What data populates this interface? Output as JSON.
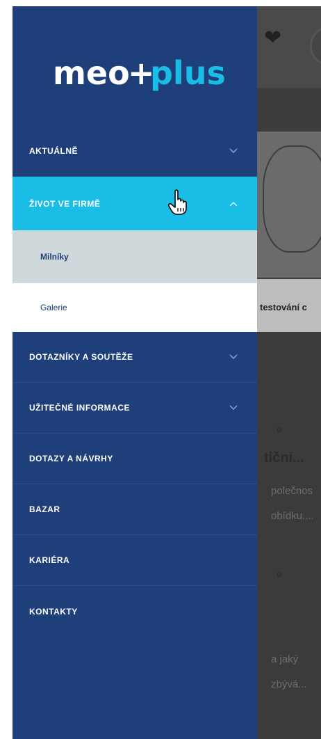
{
  "brand": {
    "logo_text": "meo+plus"
  },
  "nav": {
    "items": [
      {
        "label": "AKTUÁLNĚ",
        "has_chevron": true,
        "state": "collapsed"
      },
      {
        "label": "ŽIVOT VE FIRMĚ",
        "has_chevron": true,
        "state": "expanded"
      },
      {
        "label": "DOTAZNÍKY A SOUTĚŽE",
        "has_chevron": true,
        "state": "collapsed"
      },
      {
        "label": "UŽITEČNÉ INFORMACE",
        "has_chevron": true,
        "state": "collapsed"
      },
      {
        "label": "DOTAZY A NÁVRHY",
        "has_chevron": false
      },
      {
        "label": "BAZAR",
        "has_chevron": false
      },
      {
        "label": "KARIÉRA",
        "has_chevron": false
      },
      {
        "label": "KONTAKTY",
        "has_chevron": false
      }
    ],
    "subitems": [
      {
        "label": "Milníky",
        "state": "selected"
      },
      {
        "label": "Galerie",
        "state": "unselected"
      }
    ]
  },
  "background": {
    "card_caption": "testování c",
    "title": "tiční...",
    "line1": "polečnos",
    "line2": "obídku....",
    "line3": "a jaký",
    "line4": "zbývá...",
    "meta1": "o",
    "meta2": "o"
  },
  "colors": {
    "sidebar": "#1f3f7a",
    "active_item": "#19bde6",
    "selected_sub": "#cfd8db"
  }
}
